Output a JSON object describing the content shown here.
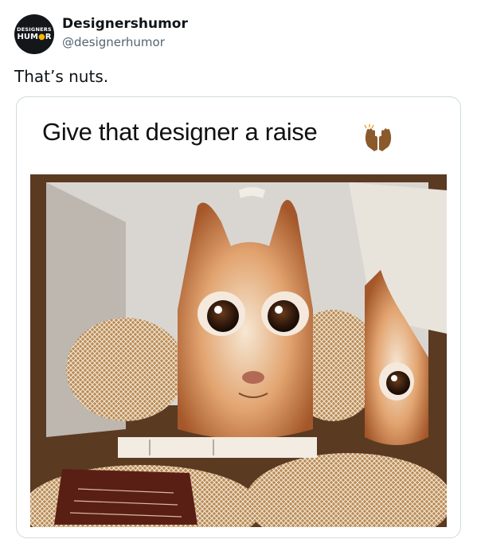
{
  "author": {
    "display_name": "Designershumor",
    "handle": "@designerhumor",
    "avatar_text": [
      "DESIGNERS",
      "HUM",
      "R"
    ]
  },
  "tweet": {
    "text": "That’s nuts."
  },
  "media": {
    "caption": "Give that designer a raise",
    "caption_emoji": "raised-hands-icon"
  },
  "colors": {
    "text": "#0f1419",
    "secondary_text": "#536471",
    "card_border": "#cfd9de",
    "avatar_bg": "#14171a",
    "avatar_accent": "#f5b800"
  }
}
